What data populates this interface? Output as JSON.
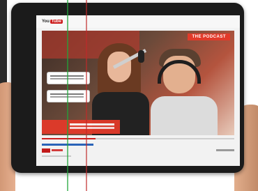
{
  "youtube": {
    "logo_you": "You",
    "logo_tube": "Tube"
  },
  "video": {
    "overlay_text": "THE PODCAST",
    "playback_progress": 0.28
  },
  "colors": {
    "brand_red": "#cc1e1e",
    "overlay_red": "#e23a2a",
    "link_blue": "#2a63b8"
  }
}
